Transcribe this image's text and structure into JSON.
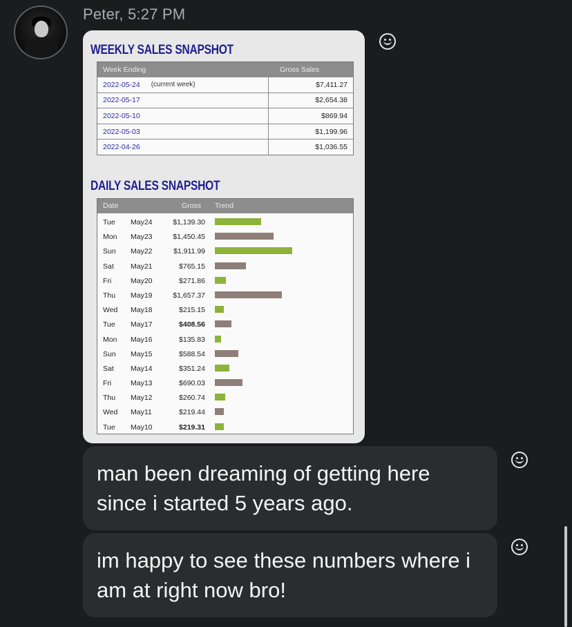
{
  "sender": {
    "name": "Peter",
    "time_label": "Peter, 5:27 PM"
  },
  "reaction_icon": "smiley-face-icon",
  "image": {
    "weekly": {
      "title": "WEEKLY SALES SNAPSHOT",
      "columns": [
        "Week Ending",
        "Gross Sales"
      ],
      "rows": [
        {
          "date": "2022-05-24",
          "note": "(current week)",
          "gross": "$7,411.27"
        },
        {
          "date": "2022-05-17",
          "note": "",
          "gross": "$2,654.38"
        },
        {
          "date": "2022-05-10",
          "note": "",
          "gross": "$869.94"
        },
        {
          "date": "2022-05-03",
          "note": "",
          "gross": "$1,199.96"
        },
        {
          "date": "2022-04-26",
          "note": "",
          "gross": "$1,036.55"
        }
      ]
    },
    "daily": {
      "title": "DAILY SALES SNAPSHOT",
      "columns": [
        "Date",
        "Gross",
        "Trend"
      ],
      "rows": [
        {
          "dow": "Tue",
          "date": "May24",
          "gross": "$1,139.30",
          "bold": false,
          "trend": "up"
        },
        {
          "dow": "Mon",
          "date": "May23",
          "gross": "$1,450.45",
          "bold": false,
          "trend": "down"
        },
        {
          "dow": "Sun",
          "date": "May22",
          "gross": "$1,911.99",
          "bold": false,
          "trend": "up"
        },
        {
          "dow": "Sat",
          "date": "May21",
          "gross": "$765.15",
          "bold": false,
          "trend": "down"
        },
        {
          "dow": "Fri",
          "date": "May20",
          "gross": "$271.86",
          "bold": false,
          "trend": "up"
        },
        {
          "dow": "Thu",
          "date": "May19",
          "gross": "$1,657.37",
          "bold": false,
          "trend": "down"
        },
        {
          "dow": "Wed",
          "date": "May18",
          "gross": "$215.15",
          "bold": false,
          "trend": "up"
        },
        {
          "dow": "Tue",
          "date": "May17",
          "gross": "$408.56",
          "bold": true,
          "trend": "down"
        },
        {
          "dow": "Mon",
          "date": "May16",
          "gross": "$135.83",
          "bold": false,
          "trend": "up"
        },
        {
          "dow": "Sun",
          "date": "May15",
          "gross": "$588.54",
          "bold": false,
          "trend": "down"
        },
        {
          "dow": "Sat",
          "date": "May14",
          "gross": "$351.24",
          "bold": false,
          "trend": "up"
        },
        {
          "dow": "Fri",
          "date": "May13",
          "gross": "$690.03",
          "bold": false,
          "trend": "down"
        },
        {
          "dow": "Thu",
          "date": "May12",
          "gross": "$260.74",
          "bold": false,
          "trend": "up"
        },
        {
          "dow": "Wed",
          "date": "May11",
          "gross": "$219.44",
          "bold": false,
          "trend": "down"
        },
        {
          "dow": "Tue",
          "date": "May10",
          "gross": "$219.31",
          "bold": true,
          "trend": "up"
        }
      ],
      "colors": {
        "up": "#8db33a",
        "down": "#8f7f78"
      }
    }
  },
  "messages": [
    {
      "text": "man been dreaming of getting here since i started 5 years ago."
    },
    {
      "text": "im happy to see these numbers where i am at right now bro!"
    }
  ]
}
